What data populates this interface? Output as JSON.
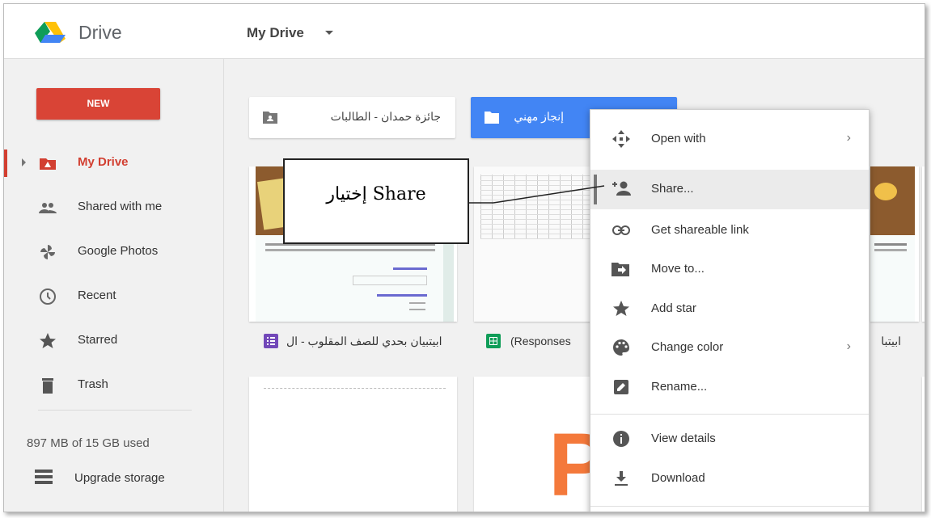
{
  "app": {
    "brand": "Drive"
  },
  "header": {
    "breadcrumb": "My Drive"
  },
  "sidebar": {
    "new_label": "NEW",
    "items": [
      {
        "label": "My Drive",
        "icon": "my-drive-icon",
        "active": true
      },
      {
        "label": "Shared with me",
        "icon": "people-icon"
      },
      {
        "label": "Google Photos",
        "icon": "pinwheel-icon"
      },
      {
        "label": "Recent",
        "icon": "clock-icon"
      },
      {
        "label": "Starred",
        "icon": "star-icon"
      },
      {
        "label": "Trash",
        "icon": "trash-icon"
      }
    ],
    "storage": "897 MB of 15 GB used",
    "upgrade_label": "Upgrade storage"
  },
  "folders": [
    {
      "name": "جائزة حمدان - الطالبات",
      "icon": "shared-folder-icon"
    },
    {
      "name": "إنجاز مهني",
      "icon": "folder-icon",
      "selected": true
    }
  ],
  "files": [
    {
      "name": "ابيتبيان بحدي للصف المقلوب - ال",
      "icon": "forms-icon"
    },
    {
      "name": "(Responses",
      "icon": "sheets-icon"
    },
    {
      "name": "ابيتبا",
      "icon": ""
    }
  ],
  "context_menu": {
    "items": [
      {
        "label": "Open with",
        "icon": "move-arrows-icon",
        "submenu": true
      },
      {
        "label": "Share...",
        "icon": "add-person-icon",
        "highlighted": true
      },
      {
        "label": "Get shareable link",
        "icon": "link-icon"
      },
      {
        "label": "Move to...",
        "icon": "move-folder-icon"
      },
      {
        "label": "Add star",
        "icon": "star-icon"
      },
      {
        "label": "Change color",
        "icon": "palette-icon",
        "submenu": true
      },
      {
        "label": "Rename...",
        "icon": "pencil-icon"
      },
      {
        "label": "View details",
        "icon": "info-icon"
      },
      {
        "label": "Download",
        "icon": "download-icon"
      }
    ],
    "submenu_arrow": "›"
  },
  "callout": {
    "text": "إختيار Share"
  },
  "colors": {
    "accent_red": "#d23f31",
    "new_button": "#d94436",
    "selected_folder": "#4285f4"
  }
}
